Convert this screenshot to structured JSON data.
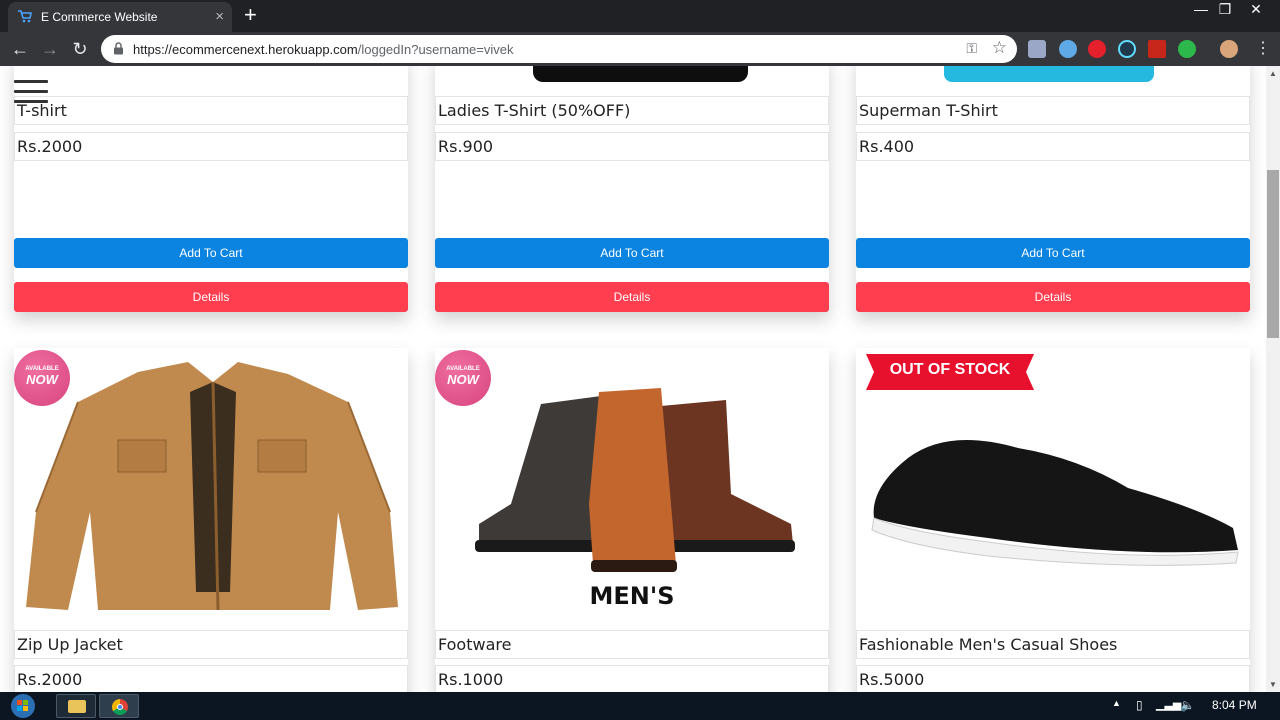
{
  "browser": {
    "tab_title": "E Commerce Website",
    "tab_close": "×",
    "new_tab": "+",
    "url_host": "https://ecommercenext.herokuapp.com",
    "url_path": "/loggedIn?username=vivek",
    "window_controls": [
      "—",
      "❐",
      "✕"
    ]
  },
  "products_top": [
    {
      "name": "T-shirt",
      "price": "Rs.2000",
      "cart_label": "Add To Cart",
      "details_label": "Details"
    },
    {
      "name": "Ladies T-Shirt (50%OFF)",
      "price": "Rs.900",
      "cart_label": "Add To Cart",
      "details_label": "Details"
    },
    {
      "name": "Superman T-Shirt",
      "price": "Rs.400",
      "cart_label": "Add To Cart",
      "details_label": "Details"
    }
  ],
  "products_bottom": [
    {
      "name": "Zip Up Jacket",
      "price": "Rs.2000",
      "badge": "available-now"
    },
    {
      "name": "Footware",
      "price": "Rs.1000",
      "badge": "available-now",
      "image_caption": "MEN'S"
    },
    {
      "name": "Fashionable Men's Casual Shoes",
      "price": "Rs.5000",
      "badge": "out-of-stock"
    }
  ],
  "badges": {
    "available_top": "AVAILABLE",
    "available_main": "NOW",
    "out_of_stock": "OUT OF STOCK"
  },
  "colors": {
    "add_to_cart": "#0a84e0",
    "details": "#ff3e4f",
    "badge_now": "#e0558e",
    "out_of_stock": "#e8112d"
  },
  "taskbar": {
    "clock": "8:04 PM"
  }
}
